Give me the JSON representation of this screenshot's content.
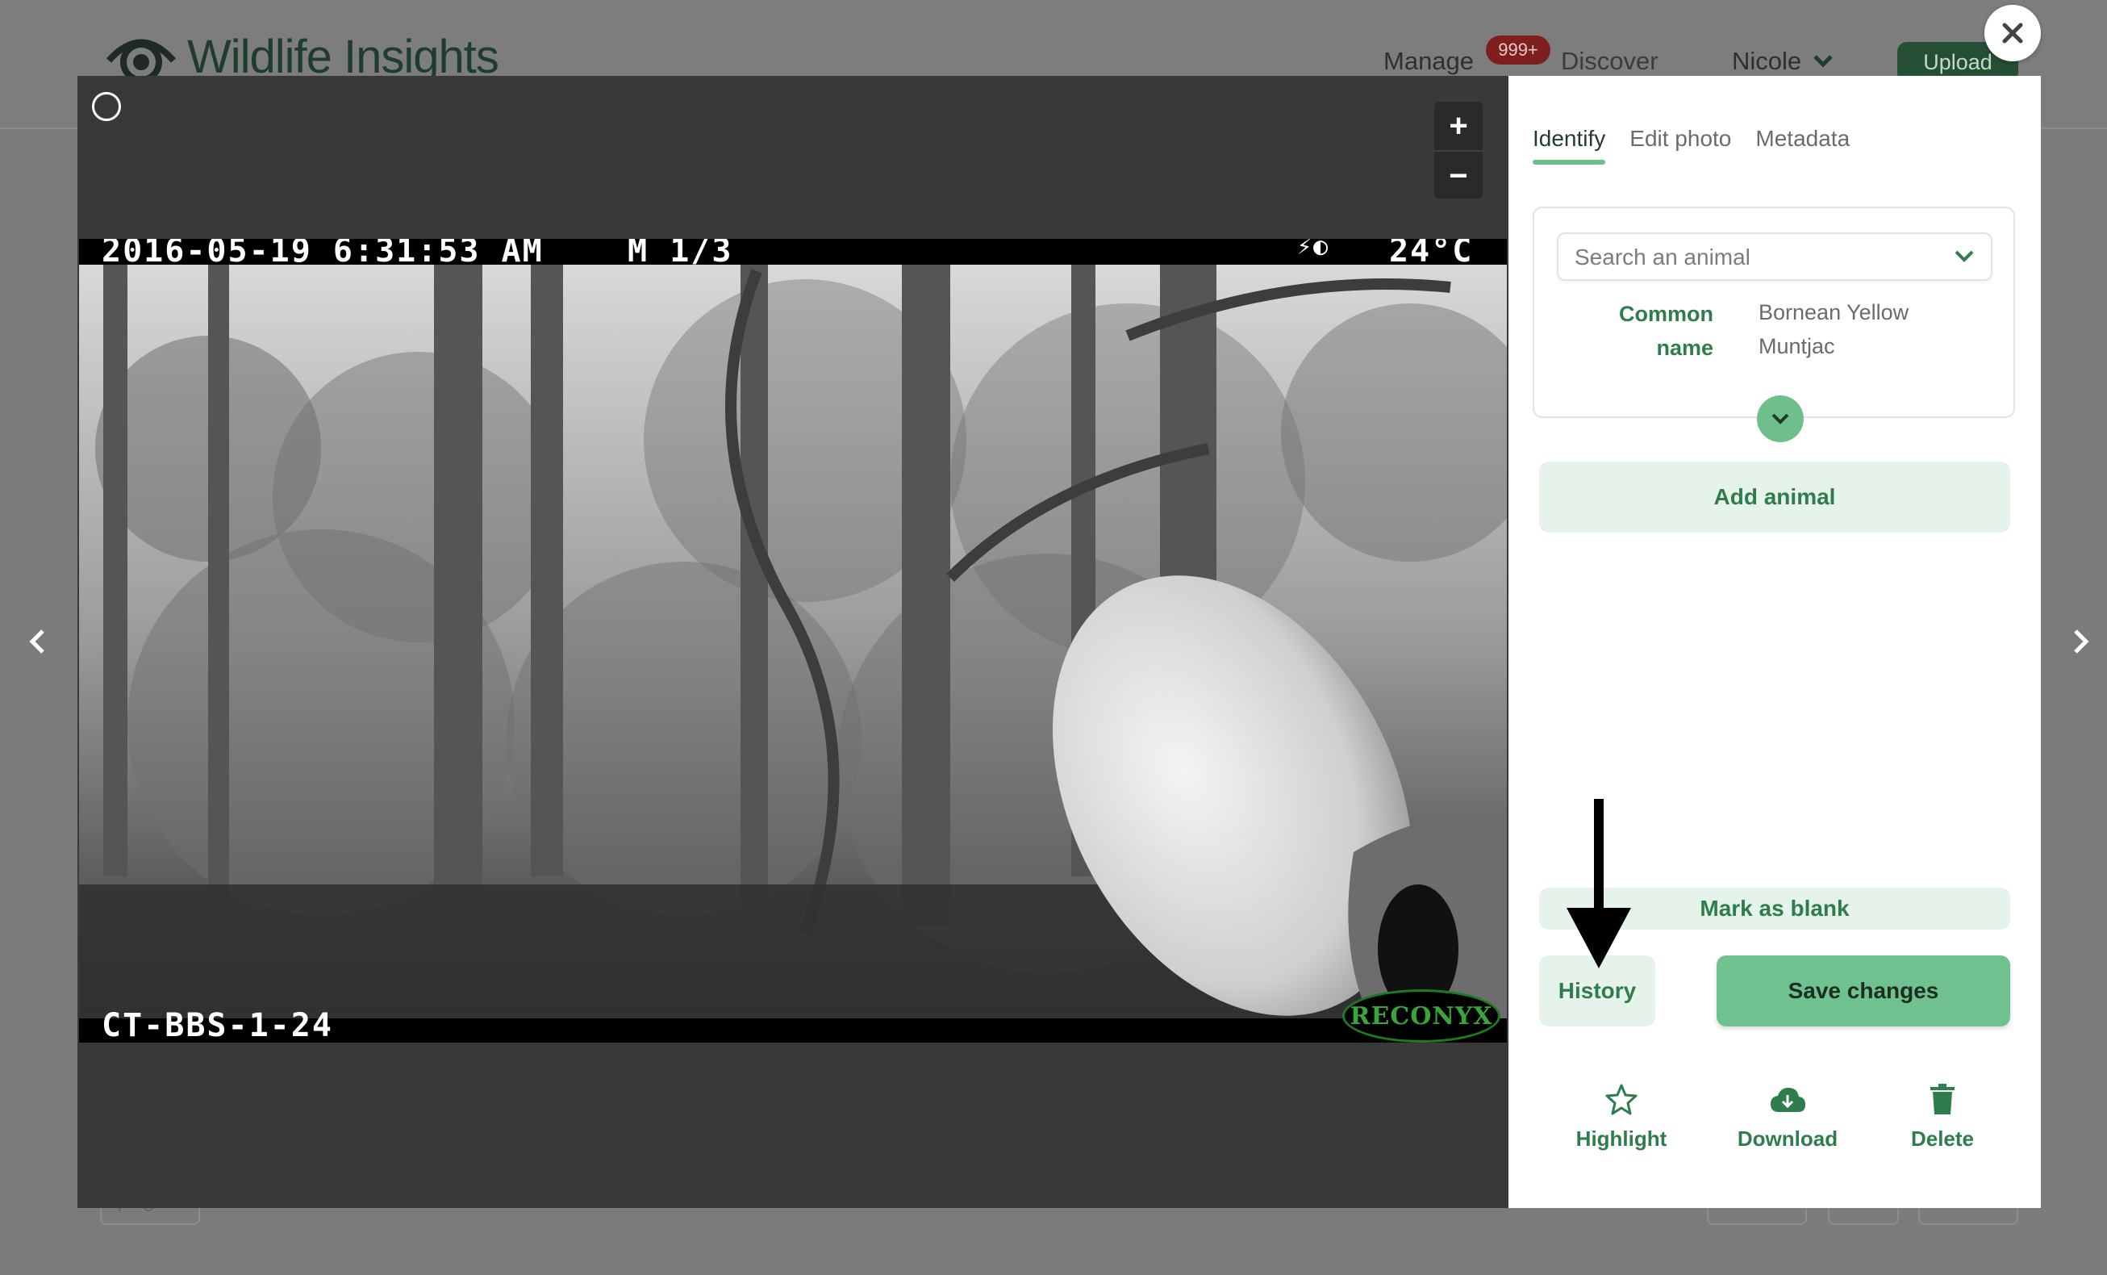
{
  "app": {
    "logo_text": "Wildlife Insights",
    "nav": {
      "manage": "Manage",
      "badge": "999+",
      "discover": "Discover",
      "user": "Nicole",
      "upload": "Upload"
    },
    "footer_fragment": "...page"
  },
  "viewer": {
    "overlay_top": "2016-05-19 6:31:53 AM    M 1/3",
    "temperature": "24°C",
    "camera_id": "CT-BBS-1-24",
    "brand": "RECONYX",
    "zoom_in": "+",
    "zoom_out": "−"
  },
  "panel": {
    "tabs": [
      {
        "label": "Identify",
        "active": true
      },
      {
        "label": "Edit photo",
        "active": false
      },
      {
        "label": "Metadata",
        "active": false
      }
    ],
    "search_placeholder": "Search an animal",
    "common_name_label": "Common name",
    "common_name_value": "Bornean Yellow Muntjac",
    "add_animal": "Add animal",
    "mark_blank": "Mark as blank",
    "history": "History",
    "save_changes": "Save changes",
    "actions": {
      "highlight": "Highlight",
      "download": "Download",
      "delete": "Delete"
    }
  },
  "colors": {
    "accent": "#6fbf8d",
    "accent_text": "#2f7d4c",
    "accent_soft": "#e6f3ea",
    "viewer_bg": "#39383b"
  },
  "icons": {
    "close": "close-icon",
    "prev": "chevron-left-icon",
    "next": "chevron-right-icon",
    "highlight": "star-icon",
    "download": "cloud-download-icon",
    "delete": "trash-icon"
  }
}
